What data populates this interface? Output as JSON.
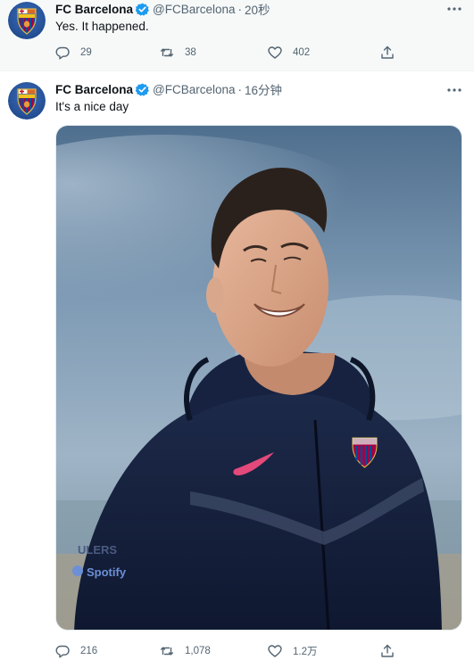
{
  "tweets": [
    {
      "author": {
        "name": "FC Barcelona",
        "handle": "@FCBarcelona",
        "avatar_icon": "fc-barcelona-crest",
        "verified_icon": "verified-badge-icon"
      },
      "separator": "·",
      "time": "20秒",
      "text": "Yes. It happened.",
      "actions": {
        "replies": "29",
        "retweets": "38",
        "likes": "402"
      }
    },
    {
      "author": {
        "name": "FC Barcelona",
        "handle": "@FCBarcelona",
        "avatar_icon": "fc-barcelona-crest",
        "verified_icon": "verified-badge-icon"
      },
      "separator": "·",
      "time": "16分钟",
      "text": "It's a nice day",
      "media": {
        "kind": "photo",
        "subject": "smiling-man-navy-hoodie",
        "logos": [
          "nike-swoosh",
          "fcb-crest"
        ],
        "jacket_text": [
          "ULERS",
          "Spotify"
        ]
      },
      "actions": {
        "replies": "216",
        "retweets": "1,078",
        "likes": "1.2万"
      }
    }
  ],
  "colors": {
    "verified": "#1d9bf0",
    "muted": "#536471",
    "text": "#0f1419",
    "barca_blue": "#004d98",
    "barca_red": "#a50044"
  }
}
